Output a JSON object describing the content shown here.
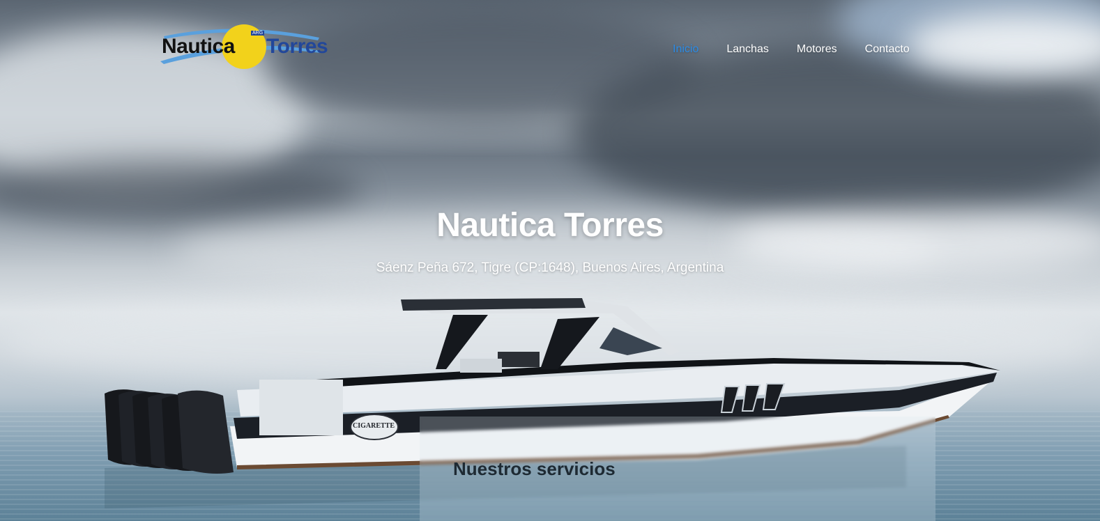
{
  "logo": {
    "part1": "Nautica",
    "part2": "Torres",
    "badge_text": "ARG"
  },
  "nav": {
    "items": [
      {
        "label": "Inicio",
        "active": true
      },
      {
        "label": "Lanchas",
        "active": false
      },
      {
        "label": "Motores",
        "active": false
      },
      {
        "label": "Contacto",
        "active": false
      }
    ]
  },
  "hero": {
    "title": "Nautica Torres",
    "address": "Sáenz Peña 672, Tigre (CP:1648), Buenos Aires, Argentina",
    "boat_name": "CIGARETTE"
  },
  "services": {
    "title": "Nuestros servicios"
  },
  "colors": {
    "nav_active": "#2b8ce6",
    "nav_default": "#ffffff",
    "logo_dark": "#111111",
    "logo_blue": "#22479a",
    "logo_yellow": "#f2d21b"
  }
}
